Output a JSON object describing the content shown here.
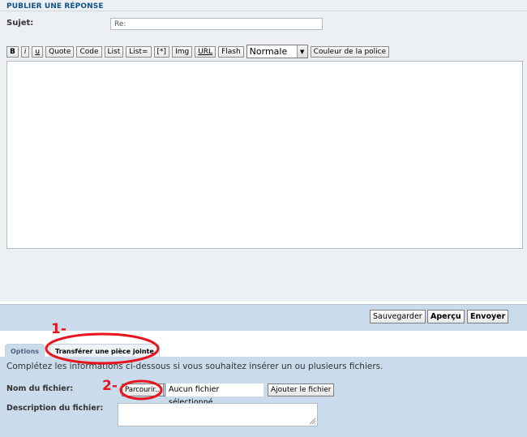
{
  "post_panel": {
    "title": "PUBLIER UNE RÉPONSE",
    "subject_label": "Sujet:",
    "subject_value": "Re:"
  },
  "toolbar": {
    "bold": "B",
    "italic": "i",
    "underline": "u",
    "quote": "Quote",
    "code": "Code",
    "list": "List",
    "list_ordered": "List=",
    "list_item": "[*]",
    "img": "Img",
    "url": "URL",
    "flash": "Flash",
    "font_size_selected": "Normale",
    "font_color": "Couleur de la police"
  },
  "actions": {
    "save": "Sauvegarder",
    "preview": "Aperçu",
    "submit": "Envoyer"
  },
  "tabs": {
    "options": "Options",
    "upload": "Transférer une pièce jointe"
  },
  "upload": {
    "help": "Complétez les informations ci-dessous si vous souhaitez insérer un ou plusieurs fichiers.",
    "file_label": "Nom du fichier:",
    "browse": "Parcourir...",
    "no_file": "Aucun fichier sélectionné.",
    "add_file": "Ajouter le fichier",
    "description_label": "Description du fichier:"
  },
  "annotations": {
    "step1": "1-",
    "step2": "2-",
    "color": "#e8131c"
  }
}
